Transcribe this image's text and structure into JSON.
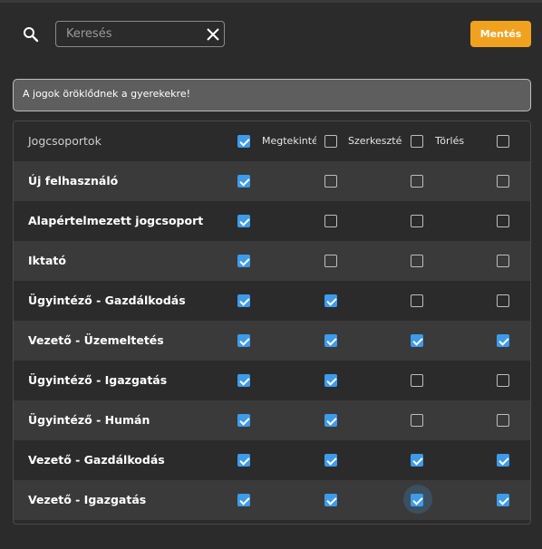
{
  "search": {
    "placeholder": "Keresés",
    "value": ""
  },
  "save_label": "Mentés",
  "info_text": "A jogok öröklődnek a gyerekekre!",
  "table": {
    "header": {
      "name": "Jogcsoportok",
      "columns": [
        {
          "label": "",
          "checked": true
        },
        {
          "label": "Megtekintés",
          "checked": false
        },
        {
          "label": "Szerkesztés",
          "checked": false
        },
        {
          "label": "Törlés",
          "checked": false
        }
      ]
    },
    "rows": [
      {
        "name": "Új felhasználó",
        "perms": [
          true,
          false,
          false,
          false
        ]
      },
      {
        "name": "Alapértelmezett jogcsoport",
        "perms": [
          true,
          false,
          false,
          false
        ]
      },
      {
        "name": "Iktató",
        "perms": [
          true,
          false,
          false,
          false
        ]
      },
      {
        "name": "Ügyintéző - Gazdálkodás",
        "perms": [
          true,
          true,
          false,
          false
        ]
      },
      {
        "name": "Vezető - Üzemeltetés",
        "perms": [
          true,
          true,
          true,
          true
        ]
      },
      {
        "name": "Ügyintéző - Igazgatás",
        "perms": [
          true,
          true,
          false,
          false
        ]
      },
      {
        "name": "Ügyintéző - Humán",
        "perms": [
          true,
          true,
          false,
          false
        ]
      },
      {
        "name": "Vezető - Gazdálkodás",
        "perms": [
          true,
          true,
          true,
          true
        ]
      },
      {
        "name": "Vezető - Igazgatás",
        "perms": [
          true,
          true,
          true,
          true
        ]
      }
    ],
    "focused": {
      "row": 8,
      "col": 2
    }
  }
}
